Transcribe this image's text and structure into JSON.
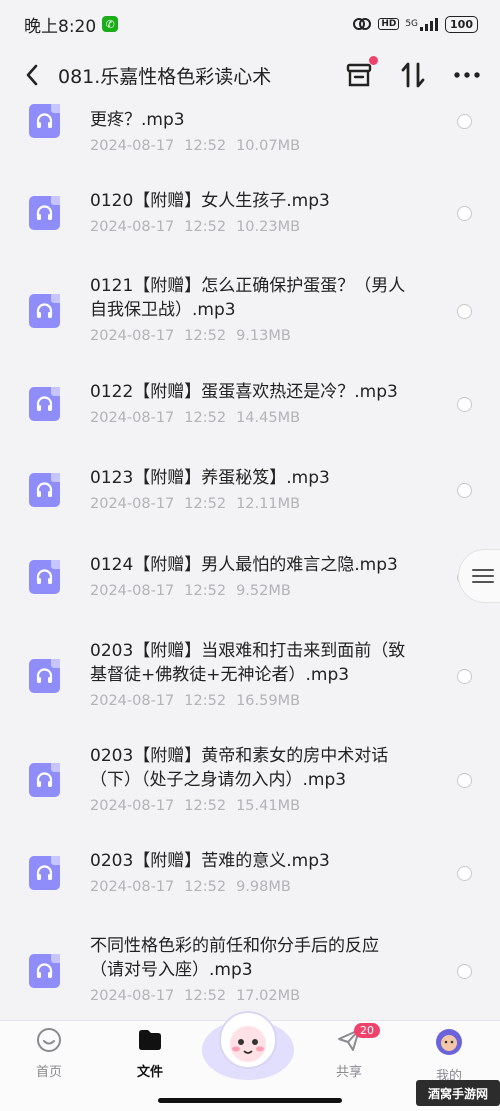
{
  "status_bar": {
    "time": "晚上8:20",
    "network": "5G",
    "battery": "100"
  },
  "nav": {
    "title": "081.乐嘉性格色彩读心术"
  },
  "files": [
    {
      "title_lines": [
        "更疼？.mp3"
      ],
      "date": "2024-08-17",
      "time": "12:52",
      "size": "10.07MB"
    },
    {
      "title_lines": [
        "0120【附赠】女人生孩子.mp3"
      ],
      "date": "2024-08-17",
      "time": "12:52",
      "size": "10.23MB"
    },
    {
      "title_lines": [
        "0121【附赠】怎么正确保护蛋蛋？（男人",
        "自我保卫战）.mp3"
      ],
      "date": "2024-08-17",
      "time": "12:52",
      "size": "9.13MB"
    },
    {
      "title_lines": [
        "0122【附赠】蛋蛋喜欢热还是冷？.mp3"
      ],
      "date": "2024-08-17",
      "time": "12:52",
      "size": "14.45MB"
    },
    {
      "title_lines": [
        "0123【附赠】养蛋秘笈】.mp3"
      ],
      "date": "2024-08-17",
      "time": "12:52",
      "size": "12.11MB"
    },
    {
      "title_lines": [
        "0124【附赠】男人最怕的难言之隐.mp3"
      ],
      "date": "2024-08-17",
      "time": "12:52",
      "size": "9.52MB"
    },
    {
      "title_lines": [
        "0203【附赠】当艰难和打击来到面前（致",
        "基督徒+佛教徒+无神论者）.mp3"
      ],
      "date": "2024-08-17",
      "time": "12:52",
      "size": "16.59MB"
    },
    {
      "title_lines": [
        "0203【附赠】黄帝和素女的房中术对话",
        "（下）（处子之身请勿入内）.mp3"
      ],
      "date": "2024-08-17",
      "time": "12:52",
      "size": "15.41MB"
    },
    {
      "title_lines": [
        "0203【附赠】苦难的意义.mp3"
      ],
      "date": "2024-08-17",
      "time": "12:52",
      "size": "9.98MB"
    },
    {
      "title_lines": [
        "不同性格色彩的前任和你分手后的反应",
        "（请对号入座）.mp3"
      ],
      "date": "2024-08-17",
      "time": "12:52",
      "size": "17.02MB"
    }
  ],
  "tabs": [
    {
      "label": "首页",
      "icon": "home-icon"
    },
    {
      "label": "文件",
      "icon": "folder-icon"
    },
    {
      "label": "共享",
      "icon": "share-icon",
      "badge": "20"
    },
    {
      "label": "我的",
      "icon": "avatar"
    }
  ],
  "watermark": "酒窝手游网",
  "colors": {
    "accent": "#8e8dfa",
    "badge": "#f0436b",
    "meta": "#b3b3b8"
  }
}
